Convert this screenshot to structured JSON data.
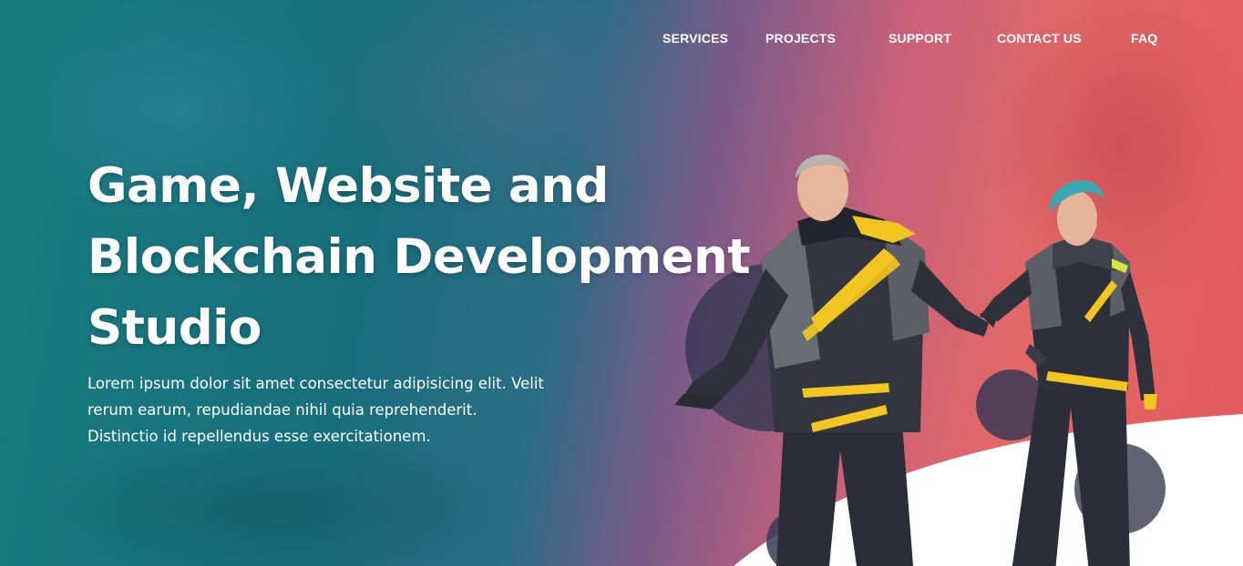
{
  "nav": {
    "items": [
      {
        "label": "SERVICES"
      },
      {
        "label": "PROJECTS"
      },
      {
        "label": "SUPPORT"
      },
      {
        "label": "CONTACT US"
      },
      {
        "label": "FAQ"
      }
    ]
  },
  "hero": {
    "headline_lines": [
      "Game, Website and",
      "Blockchain Development",
      "Studio"
    ],
    "description_lines": [
      "Lorem ipsum dolor sit amet consectetur adipisicing elit. Velit",
      "rerum earum, repudiandae nihil quia reprehenderit.",
      "Distinctio id repellendus esse exercitationem."
    ]
  },
  "colors": {
    "gradient_left": "#1a7c80",
    "gradient_right": "#e45a5c",
    "accent_yellow": "#f3c521",
    "suit_dark": "#2b2d38",
    "text": "#ffffff"
  }
}
